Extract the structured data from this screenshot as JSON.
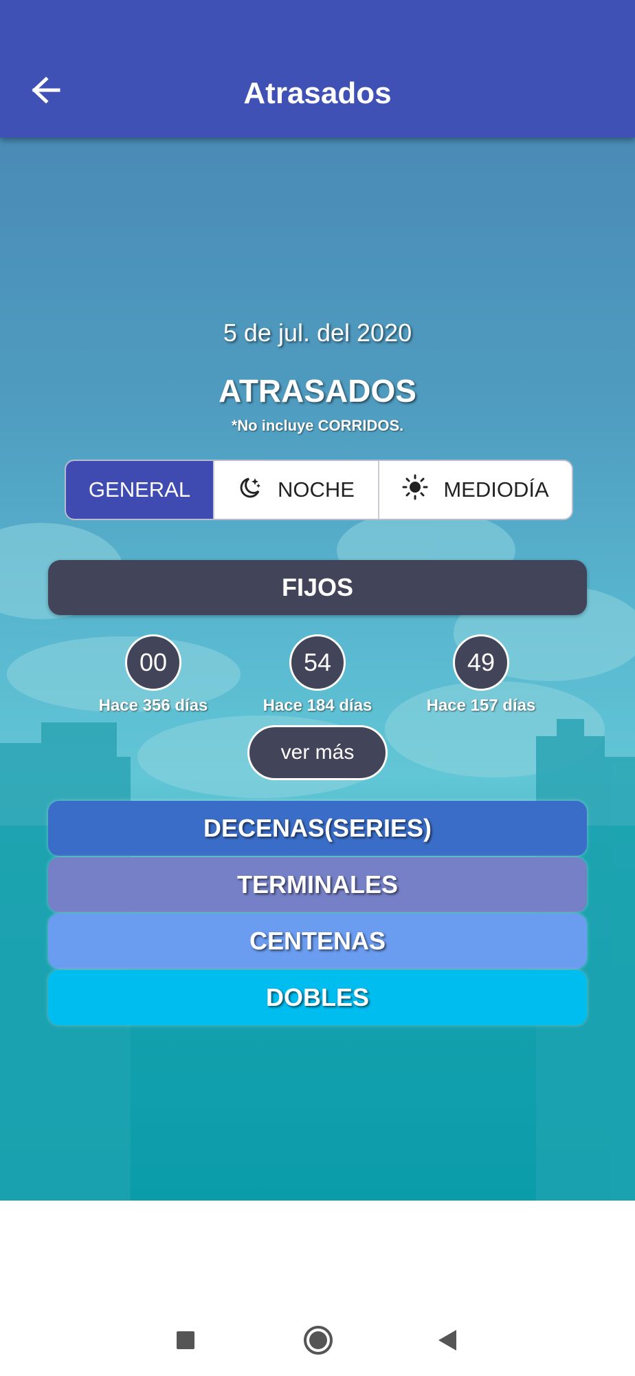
{
  "appbar": {
    "title": "Atrasados",
    "color": "#3f51b5"
  },
  "header": {
    "date": "5 de jul. del 2020",
    "title": "ATRASADOS",
    "note": "*No incluye CORRIDOS."
  },
  "segments": [
    {
      "label": "GENERAL",
      "icon": "",
      "selected": true
    },
    {
      "label": "NOCHE",
      "icon": "moon-stars-icon",
      "selected": false
    },
    {
      "label": "MEDIODÍA",
      "icon": "sun-icon",
      "selected": false
    }
  ],
  "fijos": {
    "title": "FIJOS",
    "items": [
      {
        "number": "00",
        "label": "Hace 356 días"
      },
      {
        "number": "54",
        "label": "Hace 184 días"
      },
      {
        "number": "49",
        "label": "Hace 157 días"
      }
    ],
    "more_label": "ver más"
  },
  "categories": [
    {
      "label": "DECENAS(SERIES)",
      "color": "#3a6dc7"
    },
    {
      "label": "TERMINALES",
      "color": "#7580c6"
    },
    {
      "label": "CENTENAS",
      "color": "#6a9cf0"
    },
    {
      "label": "DOBLES",
      "color": "#00bdf0"
    }
  ],
  "navbar": {
    "icons": [
      "recents-square-icon",
      "home-circle-icon",
      "back-triangle-icon"
    ]
  }
}
